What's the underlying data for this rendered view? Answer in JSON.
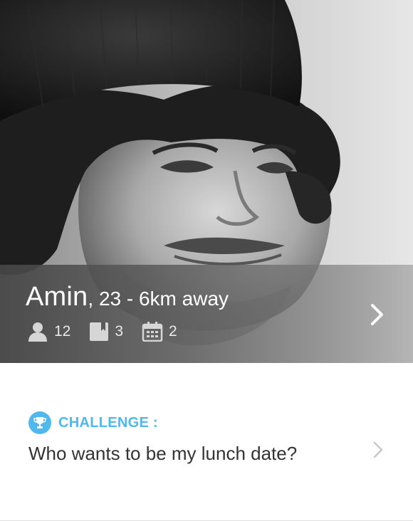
{
  "profile": {
    "name": "Amin",
    "meta": ", 23 - 6km away",
    "stats": {
      "friends": "12",
      "books": "3",
      "events": "2"
    }
  },
  "challenge": {
    "label": "CHALLENGE :",
    "text": "Who wants to be my lunch date?"
  },
  "icons": {
    "friends": "person-icon",
    "books": "bookmark-icon",
    "events": "calendar-icon",
    "challenge": "trophy-icon",
    "next": "chevron-right-icon"
  },
  "colors": {
    "accent": "#4fb8ec",
    "text_dark": "#333333",
    "overlay": "#5a5a5a"
  }
}
